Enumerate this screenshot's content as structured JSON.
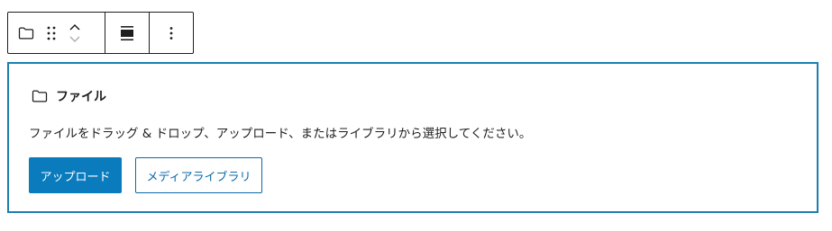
{
  "toolbar": {
    "block_icon": "folder-icon",
    "drag_icon": "drag-handle-icon",
    "move_up_icon": "chevron-up-icon",
    "move_down_icon": "chevron-down-icon",
    "align_icon": "align-wide-icon",
    "options_icon": "more-vertical-icon"
  },
  "placeholder": {
    "icon": "folder-icon",
    "title": "ファイル",
    "instructions": "ファイルをドラッグ & ドロップ、アップロード、またはライブラリから選択してください。",
    "upload_label": "アップロード",
    "media_library_label": "メディアライブラリ"
  },
  "colors": {
    "accent": "#0a7bbd",
    "focus_border": "#1b7fb0",
    "text": "#1e1e1e"
  }
}
